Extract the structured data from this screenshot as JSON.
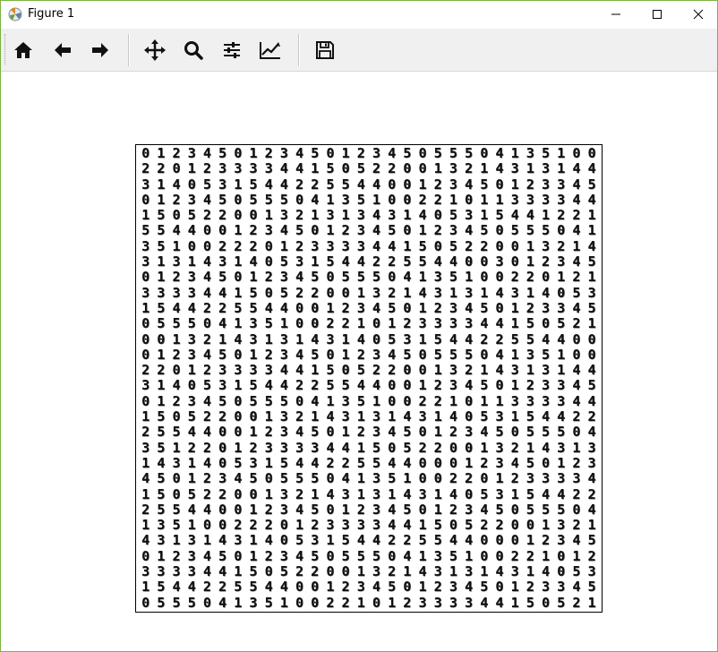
{
  "window": {
    "title": "Figure 1"
  },
  "toolbar": {
    "buttons": [
      {
        "name": "home",
        "icon": "home-icon"
      },
      {
        "name": "back",
        "icon": "arrow-left-icon"
      },
      {
        "name": "forward",
        "icon": "arrow-right-icon"
      },
      {
        "name": "pan",
        "icon": "move-icon"
      },
      {
        "name": "zoom",
        "icon": "zoom-icon"
      },
      {
        "name": "subplots",
        "icon": "sliders-icon"
      },
      {
        "name": "customize",
        "icon": "line-chart-icon"
      },
      {
        "name": "save",
        "icon": "save-icon"
      }
    ]
  },
  "figure": {
    "rows": [
      "012345012345012345055504135100",
      "220123333441505220013214313144",
      "314053154422554400123450123345",
      "012345055504135100221011333344",
      "150522001321313431405315441221",
      "554400123450123450123450555041",
      "351002220123333441505220013214",
      "313143140531544225544003012345",
      "012345012345055504135100220121",
      "333344150522001321431314314053",
      "154422554400123450123450123345",
      "055504135100221012333344150521",
      "001321431314314053154422554400",
      "012345012345012345055504135100",
      "220123333441505220013214313144",
      "314053154422554400123450123345",
      "012345055504135100221011333344",
      "150522001321431314314053154422",
      "255440012345012345012345055504",
      "351220123333441505220013214313",
      "143140531544225544000123450123",
      "450123450555041351002201233334",
      "150522001321431314314053154422",
      "255440012345012345012345055504",
      "135100222012333344150522001321",
      "431314314053154422554400012345",
      "012345012345055504135100221012",
      "333344150522001321431314314053",
      "154422554400123450123450123345",
      "055504135100221012333344150521"
    ]
  }
}
